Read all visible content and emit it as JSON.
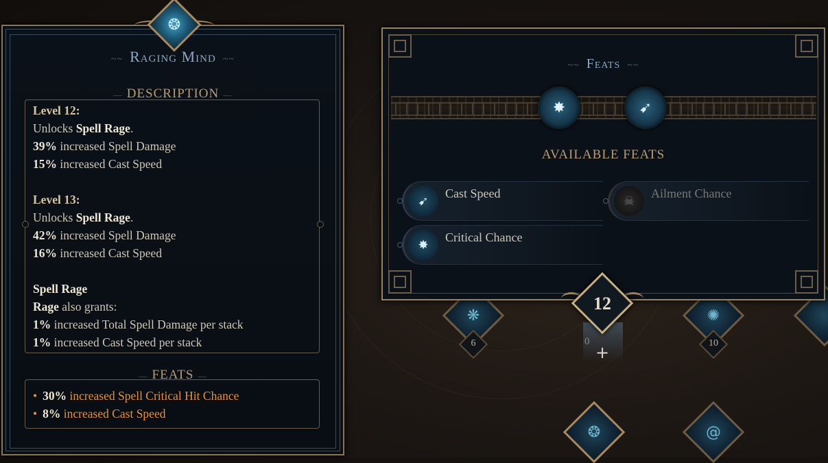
{
  "skill_panel": {
    "title": "Raging Mind",
    "description_heading": "DESCRIPTION",
    "levels": [
      {
        "header": "Level 12:",
        "lines": [
          {
            "pre": "Unlocks ",
            "bold": "Spell Rage",
            "post": "."
          },
          {
            "pre": "",
            "bold": "39%",
            "post": " increased Spell Damage"
          },
          {
            "pre": "",
            "bold": "15%",
            "post": " increased Cast Speed"
          }
        ]
      },
      {
        "header": "Level 13:",
        "lines": [
          {
            "pre": "Unlocks ",
            "bold": "Spell Rage",
            "post": "."
          },
          {
            "pre": "",
            "bold": "42%",
            "post": " increased Spell Damage"
          },
          {
            "pre": "",
            "bold": "16%",
            "post": " increased Cast Speed"
          }
        ]
      }
    ],
    "keyword": {
      "name": "Spell Rage",
      "lines": [
        {
          "pre": "",
          "bold": "Rage",
          "post": " also grants:"
        },
        {
          "pre": "",
          "bold": "1%",
          "post": " increased Total Spell Damage per stack"
        },
        {
          "pre": "",
          "bold": "1%",
          "post": " increased Cast Speed per stack"
        }
      ]
    },
    "feats_heading": "FEATS",
    "feats": [
      {
        "bold": "30%",
        "text": " increased Spell Critical Hit Chance"
      },
      {
        "bold": "8%",
        "text": " increased Cast Speed"
      }
    ]
  },
  "feats_panel": {
    "title": "Feats",
    "slots": [
      {
        "icon": "critical-chance-feat-icon",
        "glyph": "✸"
      },
      {
        "icon": "cast-speed-feat-icon",
        "glyph": "➹"
      }
    ],
    "available_heading": "AVAILABLE FEATS",
    "available": [
      {
        "label": "Cast Speed",
        "icon": "cast-speed-icon",
        "glyph": "➹",
        "locked": false
      },
      {
        "label": "Ailment Chance",
        "icon": "ailment-chance-icon",
        "glyph": "☠",
        "locked": true
      },
      {
        "label": "Critical Chance",
        "icon": "critical-chance-icon",
        "glyph": "✸",
        "locked": false
      }
    ]
  },
  "level_marker": {
    "level": "12",
    "points": "0",
    "add_glyph": "+"
  },
  "tree_nodes": [
    {
      "badge": "6"
    },
    {
      "badge": "10"
    }
  ],
  "colors": {
    "accent_gold": "#c9ad82",
    "feat_orange": "#e8903e",
    "title_blue": "#8da7c4"
  }
}
